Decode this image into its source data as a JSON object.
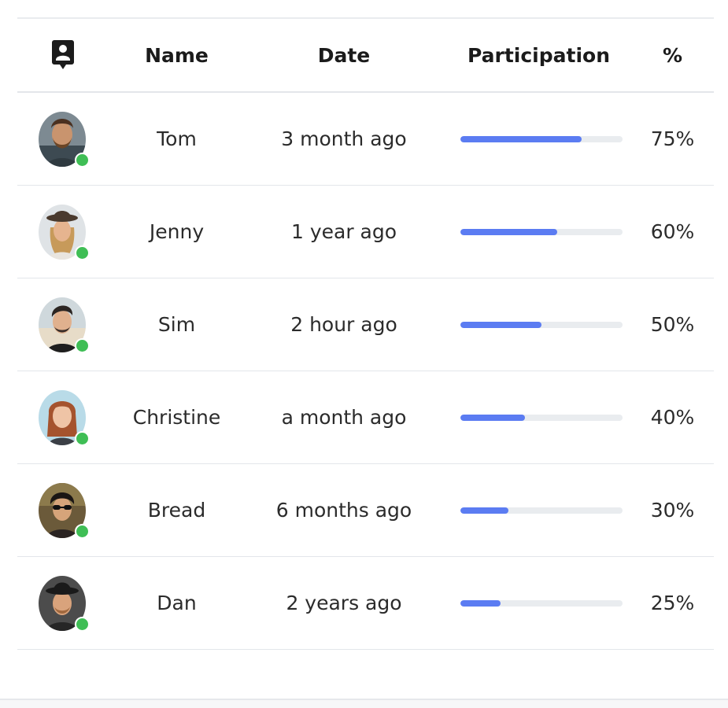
{
  "table": {
    "headers": {
      "avatar_icon": "contact-card-icon",
      "name": "Name",
      "date": "Date",
      "participation": "Participation",
      "percent": "%"
    },
    "rows": [
      {
        "name": "Tom",
        "date": "3 month ago",
        "participation": 0.75,
        "percent_label": "75%",
        "status": "online"
      },
      {
        "name": "Jenny",
        "date": "1 year ago",
        "participation": 0.6,
        "percent_label": "60%",
        "status": "online"
      },
      {
        "name": "Sim",
        "date": "2 hour ago",
        "participation": 0.5,
        "percent_label": "50%",
        "status": "online"
      },
      {
        "name": "Christine",
        "date": "a month ago",
        "participation": 0.4,
        "percent_label": "40%",
        "status": "online"
      },
      {
        "name": "Bread",
        "date": "6 months ago",
        "participation": 0.3,
        "percent_label": "30%",
        "status": "online"
      },
      {
        "name": "Dan",
        "date": "2 years ago",
        "participation": 0.25,
        "percent_label": "25%",
        "status": "online"
      }
    ]
  },
  "colors": {
    "bar_fill": "#5b7cf2",
    "bar_track": "#e9ecef",
    "status_online": "#3fbe55",
    "divider": "#e3e6ea"
  }
}
